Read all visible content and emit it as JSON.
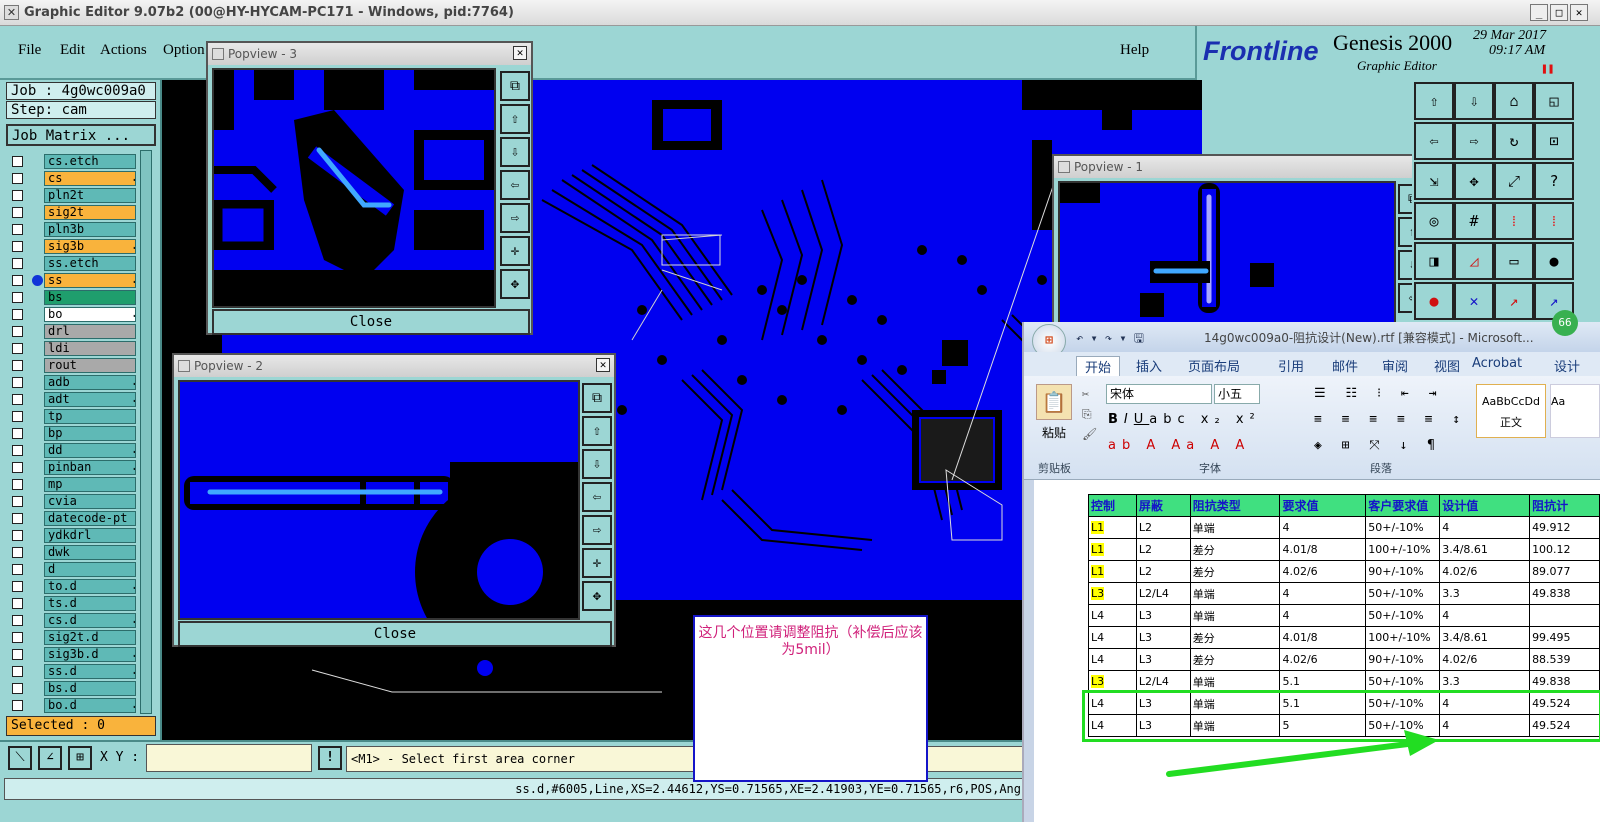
{
  "window": {
    "title": "Graphic Editor 9.07b2 (00@HY-HYCAM-PC171 - Windows, pid:7764)"
  },
  "menu": {
    "items": [
      "File",
      "Edit",
      "Actions",
      "Option"
    ],
    "help": "Help"
  },
  "brand": {
    "logo": "Frontline",
    "product": "Genesis 2000",
    "subtitle": "Graphic Editor",
    "date": "29 Mar 2017",
    "time": "09:17 AM"
  },
  "job": {
    "job_label": "Job : 4g0wc009a0",
    "step_label": "Step: cam",
    "matrix_button": "Job Matrix ..."
  },
  "layers": [
    {
      "name": "cs.etch",
      "style": ""
    },
    {
      "name": "cs",
      "style": "or",
      "arrow": true
    },
    {
      "name": "pln2t",
      "style": ""
    },
    {
      "name": "sig2t",
      "style": "or"
    },
    {
      "name": "pln3b",
      "style": ""
    },
    {
      "name": "sig3b",
      "style": "or",
      "arrow": true
    },
    {
      "name": "ss.etch",
      "style": ""
    },
    {
      "name": "ss",
      "style": "or",
      "arrow": true,
      "dot": true
    },
    {
      "name": "bs",
      "style": "gn"
    },
    {
      "name": "bo",
      "style": "wh",
      "arrow": true
    },
    {
      "name": "drl",
      "style": "gr"
    },
    {
      "name": "ldi",
      "style": "gr"
    },
    {
      "name": "rout",
      "style": "gr"
    },
    {
      "name": "adb",
      "style": "",
      "arrow": true
    },
    {
      "name": "adt",
      "style": "",
      "arrow": true
    },
    {
      "name": "tp",
      "style": ""
    },
    {
      "name": "bp",
      "style": ""
    },
    {
      "name": "dd",
      "style": "",
      "arrow": true
    },
    {
      "name": "pinban",
      "style": "",
      "arrow": true
    },
    {
      "name": "mp",
      "style": ""
    },
    {
      "name": "cvia",
      "style": ""
    },
    {
      "name": "datecode-pt",
      "style": ""
    },
    {
      "name": "ydkdrl",
      "style": ""
    },
    {
      "name": "dwk",
      "style": ""
    },
    {
      "name": "d",
      "style": ""
    },
    {
      "name": "to.d",
      "style": "",
      "arrow": true
    },
    {
      "name": "ts.d",
      "style": ""
    },
    {
      "name": "cs.d",
      "style": "",
      "arrow": true
    },
    {
      "name": "sig2t.d",
      "style": ""
    },
    {
      "name": "sig3b.d",
      "style": "",
      "arrow": true
    },
    {
      "name": "ss.d",
      "style": "",
      "arrow": true
    },
    {
      "name": "bs.d",
      "style": ""
    },
    {
      "name": "bo.d",
      "style": "",
      "arrow": true
    }
  ],
  "selected": "Selected : 0",
  "popups": {
    "p3": {
      "title": "Popview - 3",
      "close": "Close"
    },
    "p2": {
      "title": "Popview - 2",
      "close": "Close"
    },
    "p1": {
      "title": "Popview - 1"
    }
  },
  "status": {
    "xy_label": "X Y :",
    "xy_value": "",
    "prompt": "<M1> - Select first area corner",
    "info": "ss.d,#6005,Line,XS=2.44612,YS=0.71565,XE=2.41903,YE=0.71565,r6,POS,Ang"
  },
  "annotation": {
    "text": "这几个位置请调整阻抗（补偿后应该为5mil）"
  },
  "word": {
    "title": "14g0wc009a0-阻抗设计(New).rtf [兼容模式] - Microsoft...",
    "tabs": [
      "开始",
      "插入",
      "页面布局",
      "引用",
      "邮件",
      "审阅",
      "视图",
      "Acrobat",
      "设计"
    ],
    "font": "宋体",
    "size": "小五",
    "paste": "粘贴",
    "style_sample": "AaBbCcDd",
    "style_name": "正文",
    "groups": [
      "剪贴板",
      "字体",
      "段落"
    ],
    "headers": [
      "控制",
      "屏蔽",
      "阻抗类型",
      "要求值",
      "客户要求值",
      "设计值",
      "阻抗计"
    ],
    "rows": [
      [
        "L1",
        "L2",
        "单端",
        "4",
        "50+/-10%",
        "4",
        "49.912"
      ],
      [
        "L1",
        "L2",
        "差分",
        "4.01/8",
        "100+/-10%",
        "3.4/8.61",
        "100.12"
      ],
      [
        "L1",
        "L2",
        "差分",
        "4.02/6",
        "90+/-10%",
        "4.02/6",
        "89.077"
      ],
      [
        "L3",
        "L2/L4",
        "单端",
        "4",
        "50+/-10%",
        "3.3",
        "49.838"
      ],
      [
        "L4",
        "L3",
        "单端",
        "4",
        "50+/-10%",
        "4",
        ""
      ],
      [
        "L4",
        "L3",
        "差分",
        "4.01/8",
        "100+/-10%",
        "3.4/8.61",
        "99.495"
      ],
      [
        "L4",
        "L3",
        "差分",
        "4.02/6",
        "90+/-10%",
        "4.02/6",
        "88.539"
      ],
      [
        "L3",
        "L2/L4",
        "单端",
        "5.1",
        "50+/-10%",
        "3.3",
        "49.838"
      ],
      [
        "L4",
        "L3",
        "单端",
        "5.1",
        "50+/-10%",
        "4",
        "49.524"
      ],
      [
        "L4",
        "L3",
        "单端",
        "5",
        "50+/-10%",
        "4",
        "49.524"
      ]
    ],
    "highlight_rows": [
      0,
      1,
      2,
      3,
      7
    ]
  },
  "colors": {
    "panel": "#9cd6d4",
    "copper": "#0000f0",
    "accent_orange": "#f9b33c",
    "annot_text": "#d0207a",
    "arrow_green": "#22dd22"
  }
}
